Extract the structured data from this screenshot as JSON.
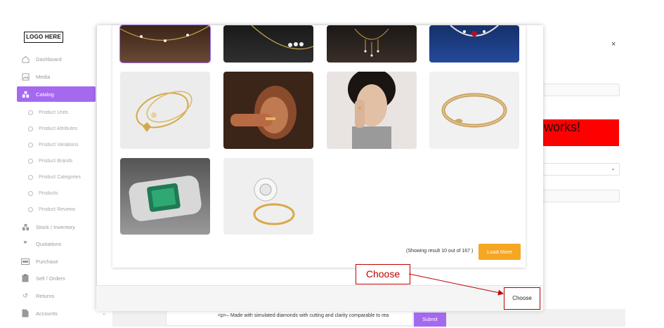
{
  "sidebar": {
    "logo": "LOGO HERE",
    "items": [
      {
        "label": "Dashboard",
        "icon": "home-icon"
      },
      {
        "label": "Media",
        "icon": "image-icon"
      },
      {
        "label": "Catalog",
        "icon": "catalog-icon",
        "active": true
      },
      {
        "label": "Stock / Inventory",
        "icon": "stock-icon"
      },
      {
        "label": "Quotations",
        "icon": "quote-icon"
      },
      {
        "label": "Purchase",
        "icon": "purchase-icon"
      },
      {
        "label": "Sell / Orders",
        "icon": "clipboard-icon"
      },
      {
        "label": "Returns",
        "icon": "undo-icon"
      },
      {
        "label": "Accounts",
        "icon": "document-icon"
      }
    ],
    "catalog_sub": [
      "Product Units",
      "Product Attributes",
      "Product Variations",
      "Product Brands",
      "Product Categories",
      "Products",
      "Product Reviews"
    ]
  },
  "background": {
    "close": "×",
    "red_box_text": "works!",
    "textarea_text": "<p>– Made with simulated diamonds with cutting and clarity comparable to rea",
    "submit_label": "Submit"
  },
  "modal": {
    "result_text": "(Showing result 10 out of 167 )",
    "load_more_label": "Load More",
    "choose_label": "Choose"
  },
  "annotation": {
    "label": "Choose"
  },
  "colors": {
    "accent": "#a569f0",
    "load_more": "#f5a623",
    "annotation": "#c00000"
  }
}
